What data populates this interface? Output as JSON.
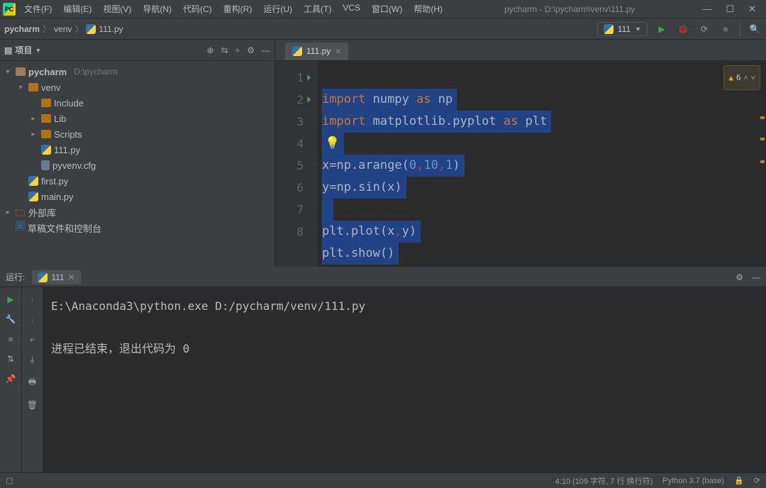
{
  "title": "pycharm - D:\\pycharm\\venv\\111.py",
  "menu": [
    "文件(F)",
    "编辑(E)",
    "视图(V)",
    "导航(N)",
    "代码(C)",
    "重构(R)",
    "运行(U)",
    "工具(T)",
    "VCS",
    "窗口(W)",
    "帮助(H)"
  ],
  "breadcrumb": {
    "p1": "pycharm",
    "p2": "venv",
    "file": "111.py"
  },
  "runConfig": "111",
  "projectPanel": {
    "label": "项目",
    "root": {
      "name": "pycharm",
      "path": "D:\\pycharm"
    },
    "venv": "venv",
    "include": "Include",
    "lib": "Lib",
    "scripts": "Scripts",
    "file111": "111.py",
    "pyvenv": "pyvenv.cfg",
    "first": "first.py",
    "main": "main.py",
    "external": "外部库",
    "scratches": "草稿文件和控制台"
  },
  "editor": {
    "tab": "111.py",
    "warningCount": "6",
    "lines": {
      "l1a": "import",
      "l1b": " numpy ",
      "l1c": "as",
      "l1d": " np",
      "l2a": "import",
      "l2b": " matplotlib.pyplot ",
      "l2c": "as",
      "l2d": " plt",
      "l4a": "x=np.arange(",
      "l4b": "0",
      "l4c": ",",
      "l4d": "10",
      "l4e": ",",
      "l4f": "1",
      "l4g": ")",
      "l5a": "y=np.sin(x)",
      "l7a": "plt.plot(x",
      "l7b": ",",
      "l7c": "y)",
      "l8a": "plt.show()"
    }
  },
  "run": {
    "label": "运行:",
    "tabName": "111",
    "out1": "E:\\Anaconda3\\python.exe D:/pycharm/venv/111.py",
    "out2": "进程已结束，退出代码为 0"
  },
  "status": {
    "pos": "4:10 (109 字符, 7 行 换行符)",
    "interp": "Python 3.7 (base)"
  }
}
